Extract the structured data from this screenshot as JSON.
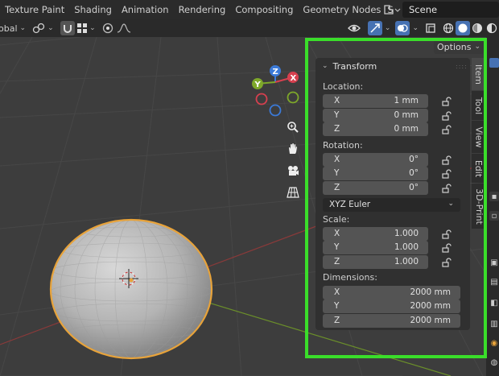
{
  "workspace_tabs": [
    "Texture Paint",
    "Shading",
    "Animation",
    "Rendering",
    "Compositing",
    "Geometry Nodes"
  ],
  "workspace_tab_partial": "obal",
  "workspace_tab_cut": "S",
  "scene": {
    "label": "Scene"
  },
  "header": {
    "orientation_value": "obal"
  },
  "options_label": "Options",
  "panel": {
    "title": "Transform",
    "location_label": "Location:",
    "rotation_label": "Rotation:",
    "scale_label": "Scale:",
    "dimensions_label": "Dimensions:",
    "location": [
      {
        "axis": "X",
        "value": "1 mm"
      },
      {
        "axis": "Y",
        "value": "0 mm"
      },
      {
        "axis": "Z",
        "value": "0 mm"
      }
    ],
    "rotation": [
      {
        "axis": "X",
        "value": "0°"
      },
      {
        "axis": "Y",
        "value": "0°"
      },
      {
        "axis": "Z",
        "value": "0°"
      }
    ],
    "rotation_mode": "XYZ Euler",
    "scale": [
      {
        "axis": "X",
        "value": "1.000"
      },
      {
        "axis": "Y",
        "value": "1.000"
      },
      {
        "axis": "Z",
        "value": "1.000"
      }
    ],
    "dimensions": [
      {
        "axis": "X",
        "value": "2000 mm"
      },
      {
        "axis": "Y",
        "value": "2000 mm"
      },
      {
        "axis": "Z",
        "value": "2000 mm"
      }
    ]
  },
  "side_tabs": [
    "Item",
    "Tool",
    "View",
    "Edit",
    "3D-Print"
  ],
  "gizmo": {
    "x": "X",
    "y": "Y",
    "z": "Z"
  },
  "colors": {
    "highlight": "#3ade2a",
    "selection_outline": "#e8a33a",
    "x_axis": "#d6404f",
    "y_axis": "#7ea82a",
    "z_axis": "#3b7ad8",
    "active_blue": "#4772b3"
  },
  "icons": [
    "magnify-icon",
    "hand-icon",
    "camera-icon",
    "grid-icon",
    "lock-icon"
  ]
}
